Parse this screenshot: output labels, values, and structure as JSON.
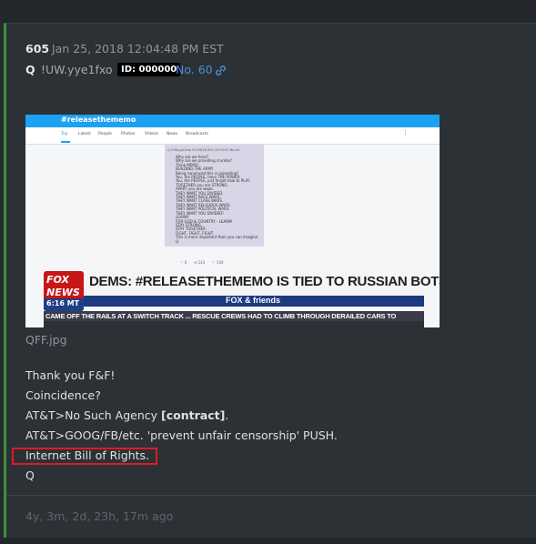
{
  "post": {
    "number": "605",
    "date": "Jan 25, 2018 12:04:48 PM EST",
    "name": "Q",
    "tripcode": "!UW.yye1fxo",
    "id_badge": "ID: 000000",
    "post_no": "No. 60",
    "link_icon": "link-icon",
    "image_filename": "QFF.jpg",
    "message": {
      "line1": "Thank you F&F!",
      "line2": "Coincidence?",
      "line3_prefix": "AT&T>No Such Agency ",
      "line3_bold": "[contract]",
      "line3_suffix": ".",
      "line4": "AT&T>GOOG/FB/etc. 'prevent unfair censorship' PUSH.",
      "line5": "Internet Bill of Rights.",
      "line6": "Q"
    },
    "time_ago": "4y, 3m, 2d, 23h, 17m ago"
  },
  "image": {
    "hashtag": "#releasethememo",
    "tabs": [
      "Top",
      "Latest",
      "People",
      "Photos",
      "Videos",
      "News",
      "Broadcasts"
    ],
    "more_icon": "⋮",
    "tweet_header": "Q !UW.yye1fxo 01/18/18 (Fri) 15:03:02 No.44",
    "tweet_body": "Why are we here?\nWhy are we providing crumbs?\nThink MEMO.\nBUILDING THE ARMY.\nBeing convinced this is spreading?\nYou, the PEOPLE, have THE POWER.\nYou, the PEOPLE, just forget how to PLAY.\nTOGETHER you are STRONG.\nAPART you are weak.\nTHEY WANT YOU DIVIDED.\nTHEY WANT RACE WARS.\nTHEY WANT CLASS WARS.\nTHEY WANT RELIGIOUS WARS.\nTHEY WANT POLITICAL WARS.\nTHEY WANT YOU DIVIDED!\nLEARN!\nFOR GOD & COUNTRY - LEARN!\nSTAY STRONG.\nSTAY TOGETHER.\nFIGHT, FIGHT, FIGHT.\nThis is more important than you can imagine.\nQ",
    "tweet_actions": "♡ 6      ⟲ 143      ♡ 144",
    "fox_logo_line1": "FOX",
    "fox_logo_line2": "NEWS",
    "fox_time": "6:16 MT",
    "headline": "DEMS: #RELEASETHEMEMO IS TIED TO RUSSIAN BOTS",
    "show_name": "FOX & friends",
    "ticker": "CAME OFF THE RAILS AT A SWITCH TRACK ... RESCUE CREWS HAD TO CLIMB THROUGH DERAILED CARS TO"
  },
  "colors": {
    "background": "#262a2e",
    "post_background": "#2c3135",
    "accent_green": "#3b8f3b",
    "link_blue": "#4a8fd6",
    "highlight_red": "#e0192a",
    "fox_red": "#c71616",
    "fox_blue": "#1b3a80",
    "twitter_blue": "#1da1f2"
  }
}
